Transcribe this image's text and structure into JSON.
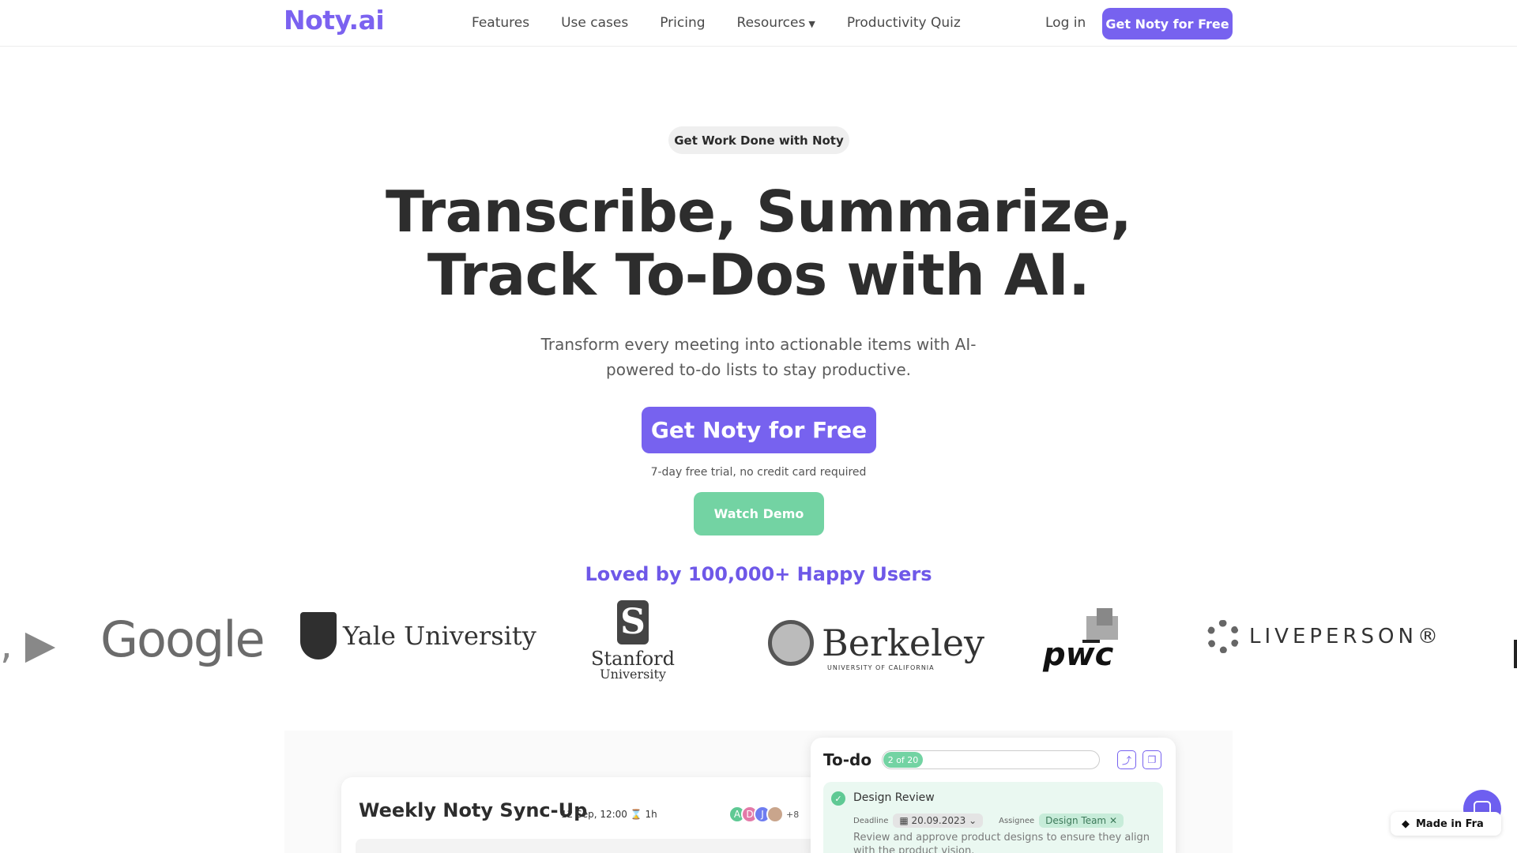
{
  "nav": {
    "logo": "Noty.ai",
    "links": [
      "Features",
      "Use cases",
      "Pricing",
      "Resources",
      "Productivity Quiz"
    ],
    "login": "Log in",
    "cta": "Get Noty for Free"
  },
  "hero": {
    "pill": "Get Work Done with Noty",
    "headline_line1": "Transcribe, Summarize,",
    "headline_line2": "Track To-Dos with AI.",
    "sub_line1": "Transform every meeting into actionable items with AI-",
    "sub_line2": "powered  to-do lists to stay productive.",
    "cta": "Get Noty for Free",
    "trial": "7-day free trial, no credit card required",
    "demo": "Watch Demo"
  },
  "social": {
    "loved": "Loved by 100,000+ Happy Users",
    "logos": {
      "google": "Google",
      "yale": "Yale University",
      "stanford_1": "Stanford",
      "stanford_2": "University",
      "berkeley": "Berkeley",
      "berkeley_sub": "UNIVERSITY OF CALIFORNIA",
      "pwc": "pwc",
      "liveperson": "LIVEPERSON®"
    }
  },
  "meeting": {
    "title": "Weekly Noty Sync-Up",
    "date": "12 Sep, 12:00",
    "duration": "1h",
    "avatars": [
      "A",
      "D",
      "J"
    ],
    "more": "+8"
  },
  "todo": {
    "title": "To-do",
    "progress_label": "2 of 20",
    "progress_fraction": 0.1,
    "task_title": "Design Review",
    "deadline_label": "Deadline",
    "deadline_value": "20.09.2023",
    "assignee_label": "Assignee",
    "assignee_value": "Design Team",
    "task_desc": "Review and approve product designs to ensure they align with the product vision."
  },
  "badge": {
    "framer": "Made in Fra"
  },
  "colors": {
    "brand": "#7762ef",
    "accent_green": "#73d3a3"
  }
}
